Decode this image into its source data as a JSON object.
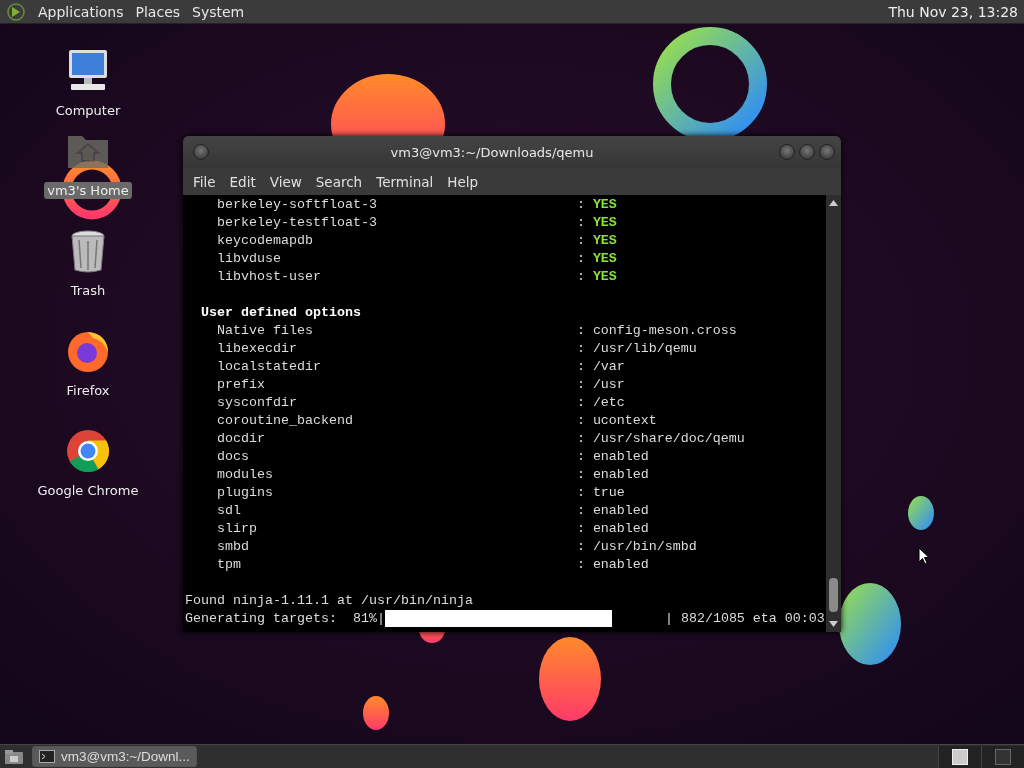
{
  "top_panel": {
    "menus": [
      "Applications",
      "Places",
      "System"
    ],
    "clock": "Thu Nov 23, 13:28"
  },
  "desktop_icons": [
    {
      "label": "Computer",
      "kind": "computer",
      "selected": false
    },
    {
      "label": "vm3's Home",
      "kind": "home",
      "selected": true
    },
    {
      "label": "Trash",
      "kind": "trash",
      "selected": false
    },
    {
      "label": "Firefox",
      "kind": "firefox",
      "selected": false
    },
    {
      "label": "Google Chrome",
      "kind": "chrome",
      "selected": false
    }
  ],
  "terminal": {
    "title": "vm3@vm3:~/Downloads/qemu",
    "menu": [
      "File",
      "Edit",
      "View",
      "Search",
      "Terminal",
      "Help"
    ],
    "lines": [
      {
        "kind": "flag",
        "key": "berkeley-softfloat-3",
        "sep": ":",
        "value": "YES"
      },
      {
        "kind": "flag",
        "key": "berkeley-testfloat-3",
        "sep": ":",
        "value": "YES"
      },
      {
        "kind": "flag",
        "key": "keycodemapdb",
        "sep": ":",
        "value": "YES"
      },
      {
        "kind": "flag",
        "key": "libvduse",
        "sep": ":",
        "value": "YES"
      },
      {
        "kind": "flag",
        "key": "libvhost-user",
        "sep": ":",
        "value": "YES"
      },
      {
        "kind": "blank"
      },
      {
        "kind": "heading",
        "text": "User defined options"
      },
      {
        "kind": "entry",
        "key": "Native files",
        "sep": ":",
        "value": "config-meson.cross"
      },
      {
        "kind": "entry",
        "key": "libexecdir",
        "sep": ":",
        "value": "/usr/lib/qemu"
      },
      {
        "kind": "entry",
        "key": "localstatedir",
        "sep": ":",
        "value": "/var"
      },
      {
        "kind": "entry",
        "key": "prefix",
        "sep": ":",
        "value": "/usr"
      },
      {
        "kind": "entry",
        "key": "sysconfdir",
        "sep": ":",
        "value": "/etc"
      },
      {
        "kind": "entry",
        "key": "coroutine_backend",
        "sep": ":",
        "value": "ucontext"
      },
      {
        "kind": "entry",
        "key": "docdir",
        "sep": ":",
        "value": "/usr/share/doc/qemu"
      },
      {
        "kind": "entry",
        "key": "docs",
        "sep": ":",
        "value": "enabled"
      },
      {
        "kind": "entry",
        "key": "modules",
        "sep": ":",
        "value": "enabled"
      },
      {
        "kind": "entry",
        "key": "plugins",
        "sep": ":",
        "value": "true"
      },
      {
        "kind": "entry",
        "key": "sdl",
        "sep": ":",
        "value": "enabled"
      },
      {
        "kind": "entry",
        "key": "slirp",
        "sep": ":",
        "value": "enabled"
      },
      {
        "kind": "entry",
        "key": "smbd",
        "sep": ":",
        "value": "/usr/bin/smbd"
      },
      {
        "kind": "entry",
        "key": "tpm",
        "sep": ":",
        "value": "enabled"
      },
      {
        "kind": "blank"
      },
      {
        "kind": "plain",
        "text": "Found ninja-1.11.1 at /usr/bin/ninja"
      },
      {
        "kind": "progress",
        "label": "Generating targets:  81%|",
        "level": 0.81,
        "end": "| 882/1085 eta 00:03"
      }
    ]
  },
  "taskbar": {
    "tasks": [
      {
        "label": "vm3@vm3:~/Downl...",
        "selected": true
      }
    ],
    "workspaces": [
      {
        "selected": true
      },
      {
        "selected": false
      }
    ]
  }
}
